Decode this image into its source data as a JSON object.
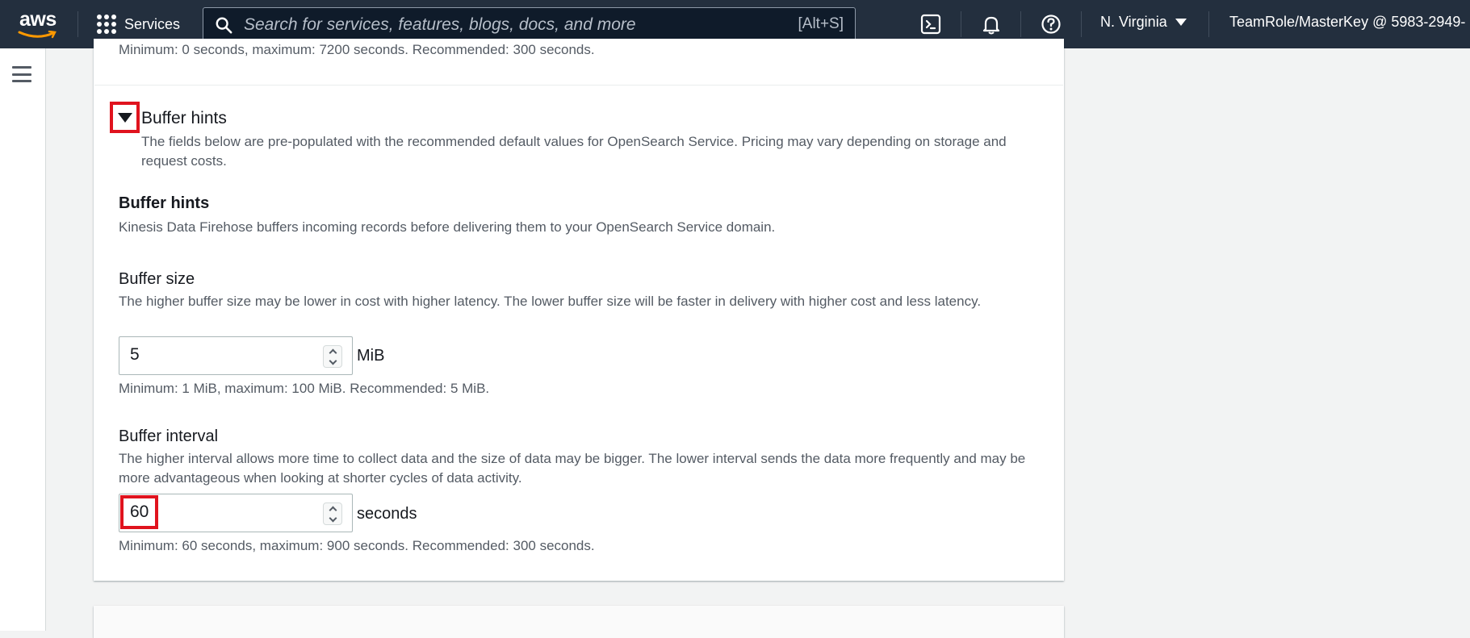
{
  "topnav": {
    "logo_text": "aws",
    "services_label": "Services",
    "search_placeholder": "Search for services, features, blogs, docs, and more",
    "search_shortcut": "[Alt+S]",
    "region": "N. Virginia",
    "account": "TeamRole/MasterKey @ 5983-2949-"
  },
  "panel": {
    "cut_off_text": "Minimum: 0 seconds, maximum: 7200 seconds. Recommended: 300 seconds.",
    "expander": {
      "title": "Buffer hints",
      "description": "The fields below are pre-populated with the recommended default values for OpenSearch Service. Pricing may vary depending on storage and request costs."
    },
    "section": {
      "title": "Buffer hints",
      "description": "Kinesis Data Firehose buffers incoming records before delivering them to your OpenSearch Service domain."
    },
    "buffer_size": {
      "label": "Buffer size",
      "description": "The higher buffer size may be lower in cost with higher latency. The lower buffer size will be faster in delivery with higher cost and less latency.",
      "value": "5",
      "unit": "MiB",
      "constraint": "Minimum: 1 MiB, maximum: 100 MiB. Recommended: 5 MiB."
    },
    "buffer_interval": {
      "label": "Buffer interval",
      "description": "The higher interval allows more time to collect data and the size of data may be bigger. The lower interval sends the data more frequently and may be more advantageous when looking at shorter cycles of data activity.",
      "value": "60",
      "unit": "seconds",
      "constraint": "Minimum: 60 seconds, maximum: 900 seconds. Recommended: 300 seconds."
    }
  },
  "colors": {
    "nav_bg": "#232f3e",
    "highlight": "#e0131e",
    "page_bg": "#f2f3f3"
  }
}
